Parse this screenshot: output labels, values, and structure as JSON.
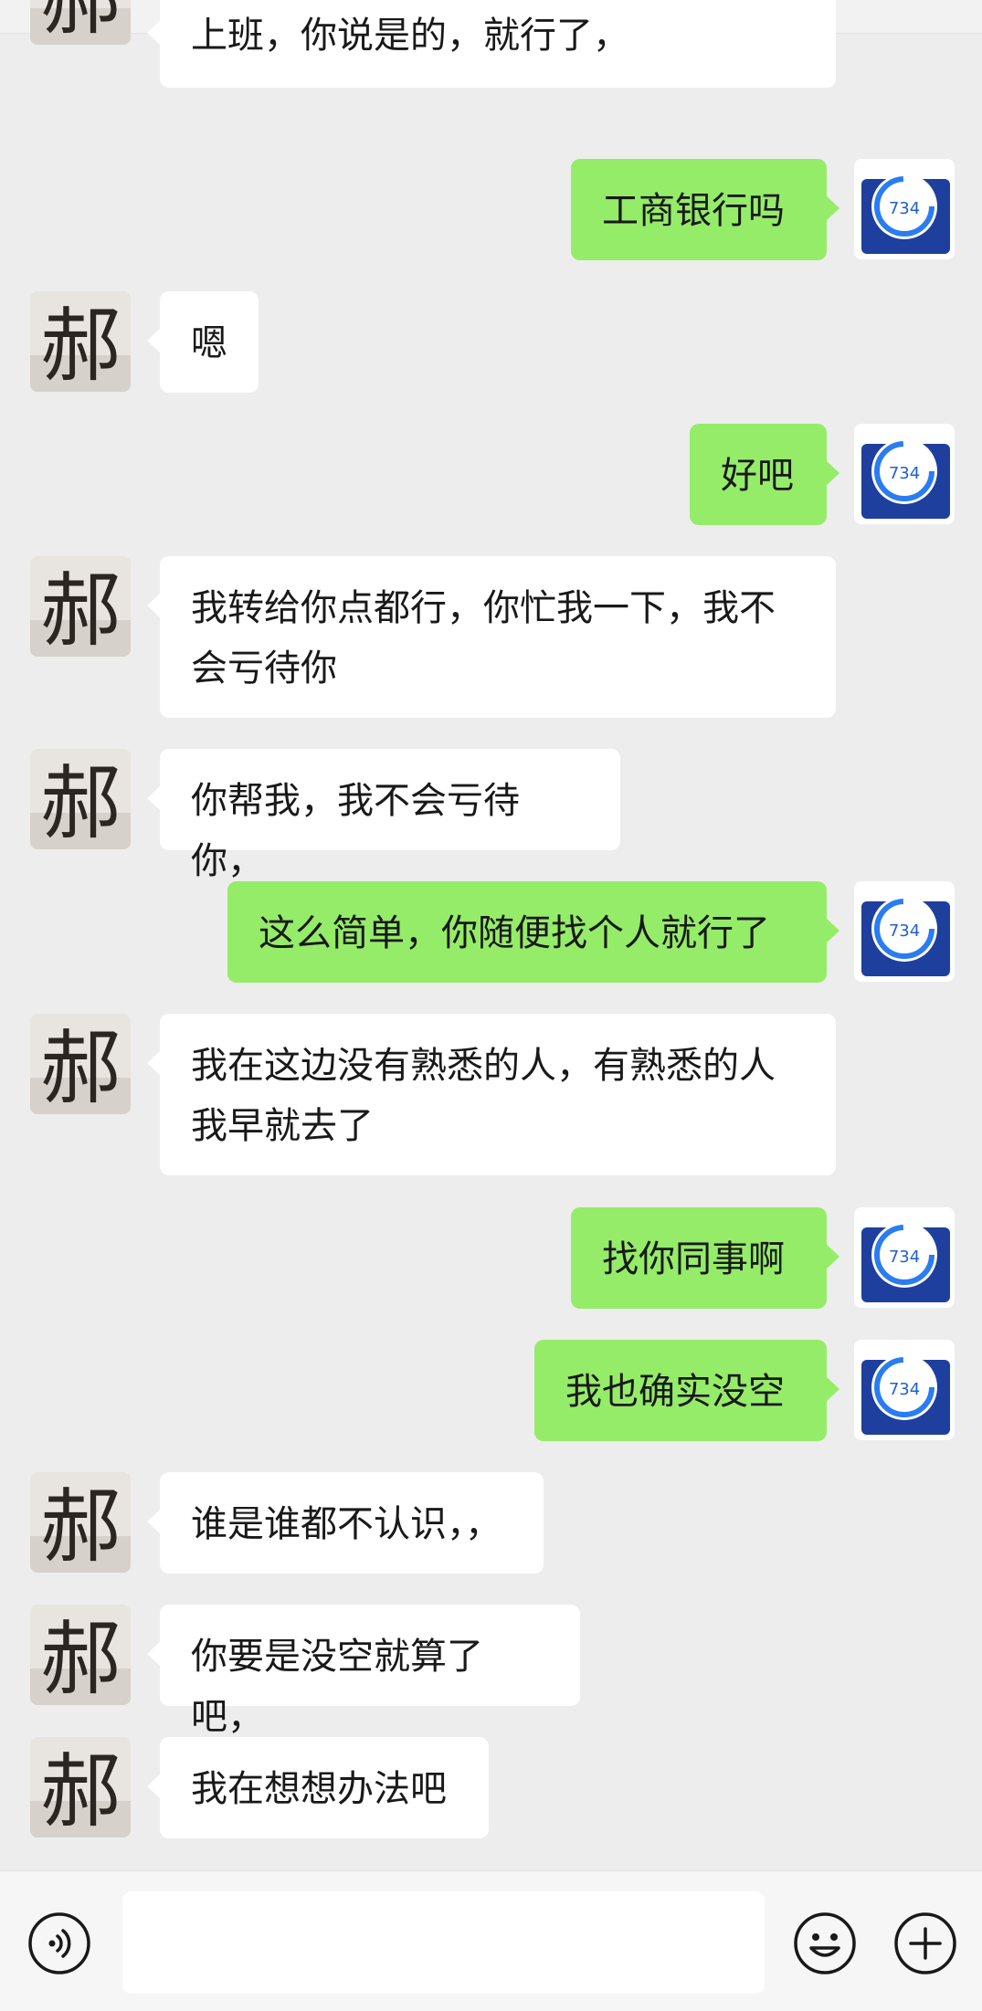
{
  "messages": [
    {
      "side": "left",
      "text": "上班，你说是的，就行了，"
    },
    {
      "side": "right",
      "text": "工商银行吗"
    },
    {
      "side": "left",
      "text": "嗯"
    },
    {
      "side": "right",
      "text": "好吧"
    },
    {
      "side": "left",
      "text": "我转给你点都行，你忙我一下，我不\n会亏待你"
    },
    {
      "side": "left",
      "text": "你帮我，我不会亏待你，"
    },
    {
      "side": "right",
      "text": "这么简单，你随便找个人就行了"
    },
    {
      "side": "left",
      "text": "我在这边没有熟悉的人，有熟悉的人\n我早就去了"
    },
    {
      "side": "right",
      "text": "找你同事啊"
    },
    {
      "side": "right",
      "text": "我也确实没空"
    },
    {
      "side": "left",
      "text": "谁是谁都不认识，，"
    },
    {
      "side": "left",
      "text": "你要是没空就算了吧，"
    },
    {
      "side": "left",
      "text": "我在想想办法吧"
    }
  ],
  "left_avatar": {
    "icon": "calligraphy-character-avatar-icon",
    "glyph": "郝"
  },
  "right_avatar": {
    "icon": "credit-score-gauge-avatar-icon",
    "score": "734"
  },
  "input_bar": {
    "voice_icon": "voice-icon",
    "emoji_icon": "emoji-icon",
    "plus_icon": "plus-icon",
    "input_value": ""
  },
  "colors": {
    "background": "#ededed",
    "sent_bubble": "#95ec69",
    "received_bubble": "#ffffff",
    "text": "#191919",
    "score_blue": "#1e5fd6"
  }
}
